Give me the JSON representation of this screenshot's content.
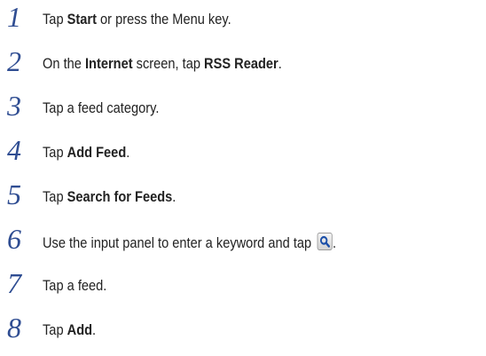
{
  "steps": [
    {
      "number": "1",
      "before": "Tap ",
      "bold": "Start",
      "after": " or press the Menu key."
    },
    {
      "number": "2",
      "before": "On the ",
      "bold": "Internet",
      "middle": " screen, tap ",
      "bold2": "RSS Reader",
      "after": "."
    },
    {
      "number": "3",
      "text": "Tap a feed category."
    },
    {
      "number": "4",
      "before": "Tap ",
      "bold": "Add Feed",
      "after": "."
    },
    {
      "number": "5",
      "before": "Tap ",
      "bold": "Search for Feeds",
      "after": "."
    },
    {
      "number": "6",
      "before": "Use the input panel to enter a keyword and tap ",
      "icon": "search-icon",
      "after": "."
    },
    {
      "number": "7",
      "text": "Tap a feed."
    },
    {
      "number": "8",
      "before": "Tap ",
      "bold": "Add",
      "after": "."
    }
  ],
  "colors": {
    "step_number": "#2f4d92",
    "body_text": "#222222"
  }
}
